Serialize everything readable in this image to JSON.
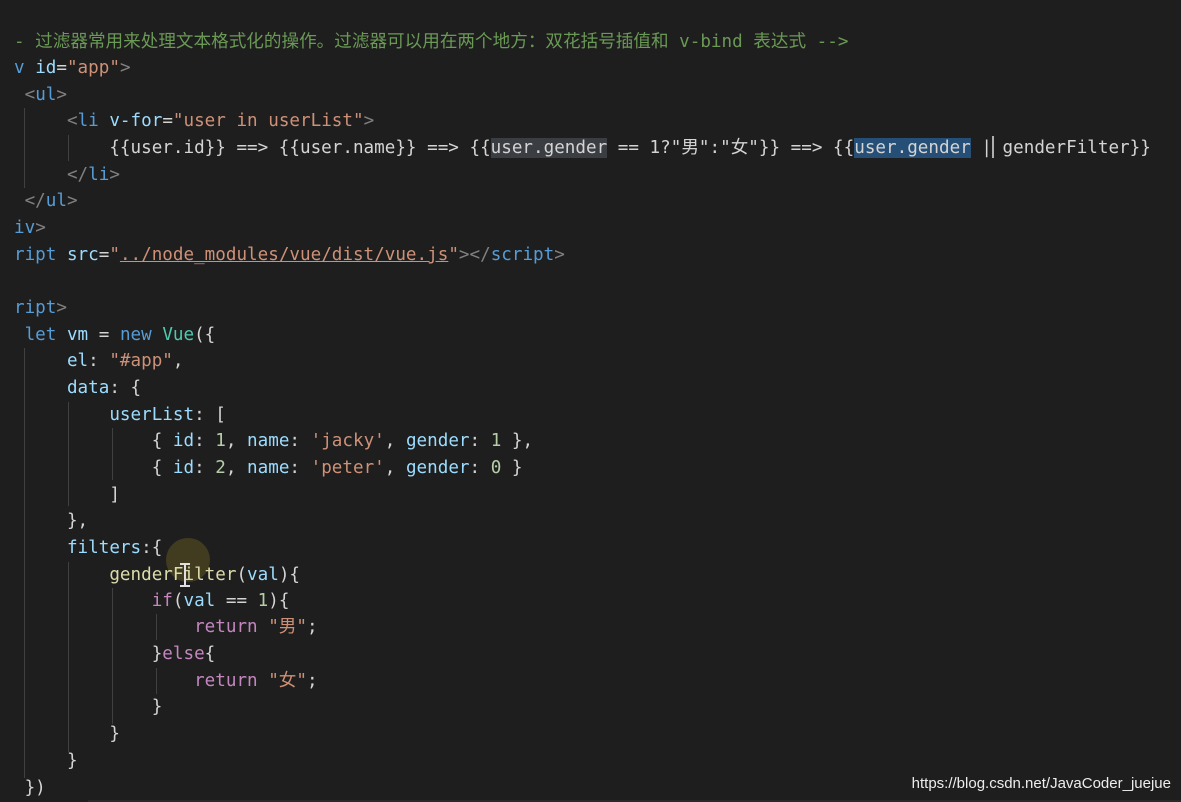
{
  "code_lines": [
    {
      "id": "l1",
      "tokens": [
        {
          "t": "- 过滤器常用来处理文本格式化的操作。过滤器可以用在两个地方：双花括号插值和 v-bind 表达式 -->",
          "c": "cmt"
        }
      ]
    },
    {
      "id": "l2",
      "tokens": [
        {
          "t": "v ",
          "c": "tag"
        },
        {
          "t": "id",
          "c": "attr"
        },
        {
          "t": "=",
          "c": "op"
        },
        {
          "t": "\"app\"",
          "c": "str"
        },
        {
          "t": ">",
          "c": "ang"
        }
      ]
    },
    {
      "id": "l3",
      "tokens": [
        {
          "t": " <",
          "c": "ang"
        },
        {
          "t": "ul",
          "c": "tag"
        },
        {
          "t": ">",
          "c": "ang"
        }
      ]
    },
    {
      "id": "l4",
      "tokens": [
        {
          "t": "     <",
          "c": "ang"
        },
        {
          "t": "li ",
          "c": "tag"
        },
        {
          "t": "v-for",
          "c": "attr"
        },
        {
          "t": "=",
          "c": "op"
        },
        {
          "t": "\"user in userList\"",
          "c": "str"
        },
        {
          "t": ">",
          "c": "ang"
        }
      ]
    },
    {
      "id": "l5",
      "tokens": [
        {
          "t": "         {{user.id}} ==> {{user.name}} ==> {{",
          "c": "op"
        },
        {
          "t": "user.gender",
          "c": "op",
          "hl": "weak"
        },
        {
          "t": " == 1?\"男\":\"女\"}} ==> {{",
          "c": "op"
        },
        {
          "t": "user.gender",
          "c": "op",
          "hl": "strong"
        },
        {
          "t": " | genderFilter}}",
          "c": "op"
        }
      ]
    },
    {
      "id": "l6",
      "tokens": [
        {
          "t": "     </",
          "c": "ang"
        },
        {
          "t": "li",
          "c": "tag"
        },
        {
          "t": ">",
          "c": "ang"
        }
      ]
    },
    {
      "id": "l7",
      "tokens": [
        {
          "t": " </",
          "c": "ang"
        },
        {
          "t": "ul",
          "c": "tag"
        },
        {
          "t": ">",
          "c": "ang"
        }
      ]
    },
    {
      "id": "l8",
      "tokens": [
        {
          "t": "iv",
          "c": "tag"
        },
        {
          "t": ">",
          "c": "ang"
        }
      ]
    },
    {
      "id": "l9",
      "tokens": [
        {
          "t": "ript ",
          "c": "tag"
        },
        {
          "t": "src",
          "c": "attr"
        },
        {
          "t": "=",
          "c": "op"
        },
        {
          "t": "\"",
          "c": "str"
        },
        {
          "t": "../node_modules/vue/dist/vue.js",
          "c": "link"
        },
        {
          "t": "\"",
          "c": "str"
        },
        {
          "t": "></",
          "c": "ang"
        },
        {
          "t": "script",
          "c": "tag"
        },
        {
          "t": ">",
          "c": "ang"
        }
      ]
    },
    {
      "id": "l10",
      "tokens": []
    },
    {
      "id": "l11",
      "tokens": [
        {
          "t": "ript",
          "c": "tag"
        },
        {
          "t": ">",
          "c": "ang"
        }
      ]
    },
    {
      "id": "l12",
      "tokens": [
        {
          "t": " let ",
          "c": "kw"
        },
        {
          "t": "vm",
          "c": "var"
        },
        {
          "t": " = ",
          "c": "op"
        },
        {
          "t": "new ",
          "c": "kw"
        },
        {
          "t": "Vue",
          "c": "cls"
        },
        {
          "t": "({",
          "c": "op"
        }
      ]
    },
    {
      "id": "l13",
      "tokens": [
        {
          "t": "     el",
          "c": "var"
        },
        {
          "t": ": ",
          "c": "op"
        },
        {
          "t": "\"#app\"",
          "c": "str"
        },
        {
          "t": ",",
          "c": "op"
        }
      ]
    },
    {
      "id": "l14",
      "tokens": [
        {
          "t": "     data",
          "c": "var"
        },
        {
          "t": ": {",
          "c": "op"
        }
      ]
    },
    {
      "id": "l15",
      "tokens": [
        {
          "t": "         userList",
          "c": "var"
        },
        {
          "t": ": [",
          "c": "op"
        }
      ]
    },
    {
      "id": "l16",
      "tokens": [
        {
          "t": "             { ",
          "c": "op"
        },
        {
          "t": "id",
          "c": "var"
        },
        {
          "t": ": ",
          "c": "op"
        },
        {
          "t": "1",
          "c": "num"
        },
        {
          "t": ", ",
          "c": "op"
        },
        {
          "t": "name",
          "c": "var"
        },
        {
          "t": ": ",
          "c": "op"
        },
        {
          "t": "'jacky'",
          "c": "str"
        },
        {
          "t": ", ",
          "c": "op"
        },
        {
          "t": "gender",
          "c": "var"
        },
        {
          "t": ": ",
          "c": "op"
        },
        {
          "t": "1",
          "c": "num"
        },
        {
          "t": " },",
          "c": "op"
        }
      ]
    },
    {
      "id": "l17",
      "tokens": [
        {
          "t": "             { ",
          "c": "op"
        },
        {
          "t": "id",
          "c": "var"
        },
        {
          "t": ": ",
          "c": "op"
        },
        {
          "t": "2",
          "c": "num"
        },
        {
          "t": ", ",
          "c": "op"
        },
        {
          "t": "name",
          "c": "var"
        },
        {
          "t": ": ",
          "c": "op"
        },
        {
          "t": "'peter'",
          "c": "str"
        },
        {
          "t": ", ",
          "c": "op"
        },
        {
          "t": "gender",
          "c": "var"
        },
        {
          "t": ": ",
          "c": "op"
        },
        {
          "t": "0",
          "c": "num"
        },
        {
          "t": " }",
          "c": "op"
        }
      ]
    },
    {
      "id": "l18",
      "tokens": [
        {
          "t": "         ]",
          "c": "op"
        }
      ]
    },
    {
      "id": "l19",
      "tokens": [
        {
          "t": "     },",
          "c": "op"
        }
      ]
    },
    {
      "id": "l20",
      "tokens": [
        {
          "t": "     filters",
          "c": "var"
        },
        {
          "t": ":{",
          "c": "op"
        }
      ]
    },
    {
      "id": "l21",
      "tokens": [
        {
          "t": "         genderFilter",
          "c": "fn"
        },
        {
          "t": "(",
          "c": "op"
        },
        {
          "t": "val",
          "c": "var"
        },
        {
          "t": "){",
          "c": "op"
        }
      ]
    },
    {
      "id": "l22",
      "tokens": [
        {
          "t": "             if",
          "c": "ctl"
        },
        {
          "t": "(",
          "c": "op"
        },
        {
          "t": "val",
          "c": "var"
        },
        {
          "t": " == ",
          "c": "op"
        },
        {
          "t": "1",
          "c": "num"
        },
        {
          "t": "){",
          "c": "op"
        }
      ]
    },
    {
      "id": "l23",
      "tokens": [
        {
          "t": "                 return ",
          "c": "ctl"
        },
        {
          "t": "\"男\"",
          "c": "str"
        },
        {
          "t": ";",
          "c": "op"
        }
      ]
    },
    {
      "id": "l24",
      "tokens": [
        {
          "t": "             }",
          "c": "op"
        },
        {
          "t": "else",
          "c": "ctl"
        },
        {
          "t": "{",
          "c": "op"
        }
      ]
    },
    {
      "id": "l25",
      "tokens": [
        {
          "t": "                 return ",
          "c": "ctl"
        },
        {
          "t": "\"女\"",
          "c": "str"
        },
        {
          "t": ";",
          "c": "op"
        }
      ]
    },
    {
      "id": "l26",
      "tokens": [
        {
          "t": "             }",
          "c": "op"
        }
      ]
    },
    {
      "id": "l27",
      "tokens": [
        {
          "t": "         }",
          "c": "op"
        }
      ]
    },
    {
      "id": "l28",
      "tokens": [
        {
          "t": "     }",
          "c": "op"
        }
      ]
    },
    {
      "id": "l29",
      "tokens": [
        {
          "t": " })",
          "c": "op"
        }
      ]
    }
  ],
  "watermark": "https://blog.csdn.net/JavaCoder_juejue",
  "colors": {
    "background": "#1e1e1e",
    "comment": "#6a9955",
    "tag": "#569cd6",
    "attribute": "#9cdcfe",
    "string": "#ce9178",
    "selection": "#264f78"
  }
}
